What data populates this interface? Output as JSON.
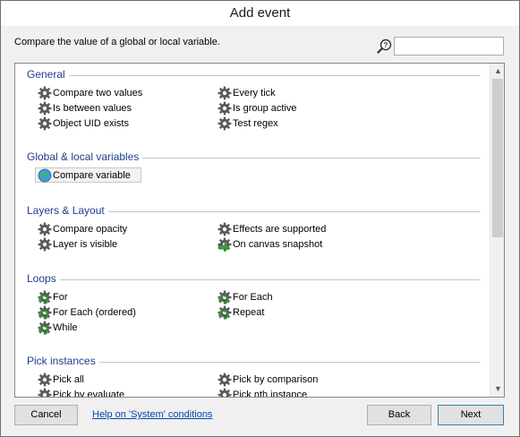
{
  "window": {
    "title": "Add event"
  },
  "header": {
    "description": "Compare the value of a global or local variable.",
    "search_placeholder": "",
    "search_icon": "magnifier-help-icon"
  },
  "categories": [
    {
      "title": "General",
      "items": [
        {
          "label": "Compare two values",
          "icon": "gear-icon"
        },
        {
          "label": "Every tick",
          "icon": "gear-icon"
        },
        {
          "label": "Is between values",
          "icon": "gear-icon"
        },
        {
          "label": "Is group active",
          "icon": "gear-icon"
        },
        {
          "label": "Object UID exists",
          "icon": "gear-icon"
        },
        {
          "label": "Test regex",
          "icon": "gear-icon"
        }
      ]
    },
    {
      "title": "Global & local variables",
      "items": [
        {
          "label": "Compare variable",
          "icon": "globe-icon",
          "selected": true
        }
      ]
    },
    {
      "title": "Layers & Layout",
      "items": [
        {
          "label": "Compare opacity",
          "icon": "gear-icon"
        },
        {
          "label": "Effects are supported",
          "icon": "gear-icon"
        },
        {
          "label": "Layer is visible",
          "icon": "gear-icon"
        },
        {
          "label": "On canvas snapshot",
          "icon": "gear-trigger-icon"
        }
      ]
    },
    {
      "title": "Loops",
      "items": [
        {
          "label": "For",
          "icon": "gear-loop-icon"
        },
        {
          "label": "For Each",
          "icon": "gear-loop-icon"
        },
        {
          "label": "For Each (ordered)",
          "icon": "gear-loop-icon"
        },
        {
          "label": "Repeat",
          "icon": "gear-loop-icon"
        },
        {
          "label": "While",
          "icon": "gear-loop-icon"
        }
      ]
    },
    {
      "title": "Pick instances",
      "items": [
        {
          "label": "Pick all",
          "icon": "gear-icon"
        },
        {
          "label": "Pick by comparison",
          "icon": "gear-icon"
        },
        {
          "label": "Pick by evaluate",
          "icon": "gear-icon"
        },
        {
          "label": "Pick nth instance",
          "icon": "gear-icon"
        }
      ]
    }
  ],
  "footer": {
    "cancel_label": "Cancel",
    "help_link": "Help on 'System' conditions",
    "back_label": "Back",
    "next_label": "Next"
  },
  "colors": {
    "category_title": "#1e3f8a",
    "link": "#0645ad",
    "default_button_border": "#3c7fb1"
  }
}
